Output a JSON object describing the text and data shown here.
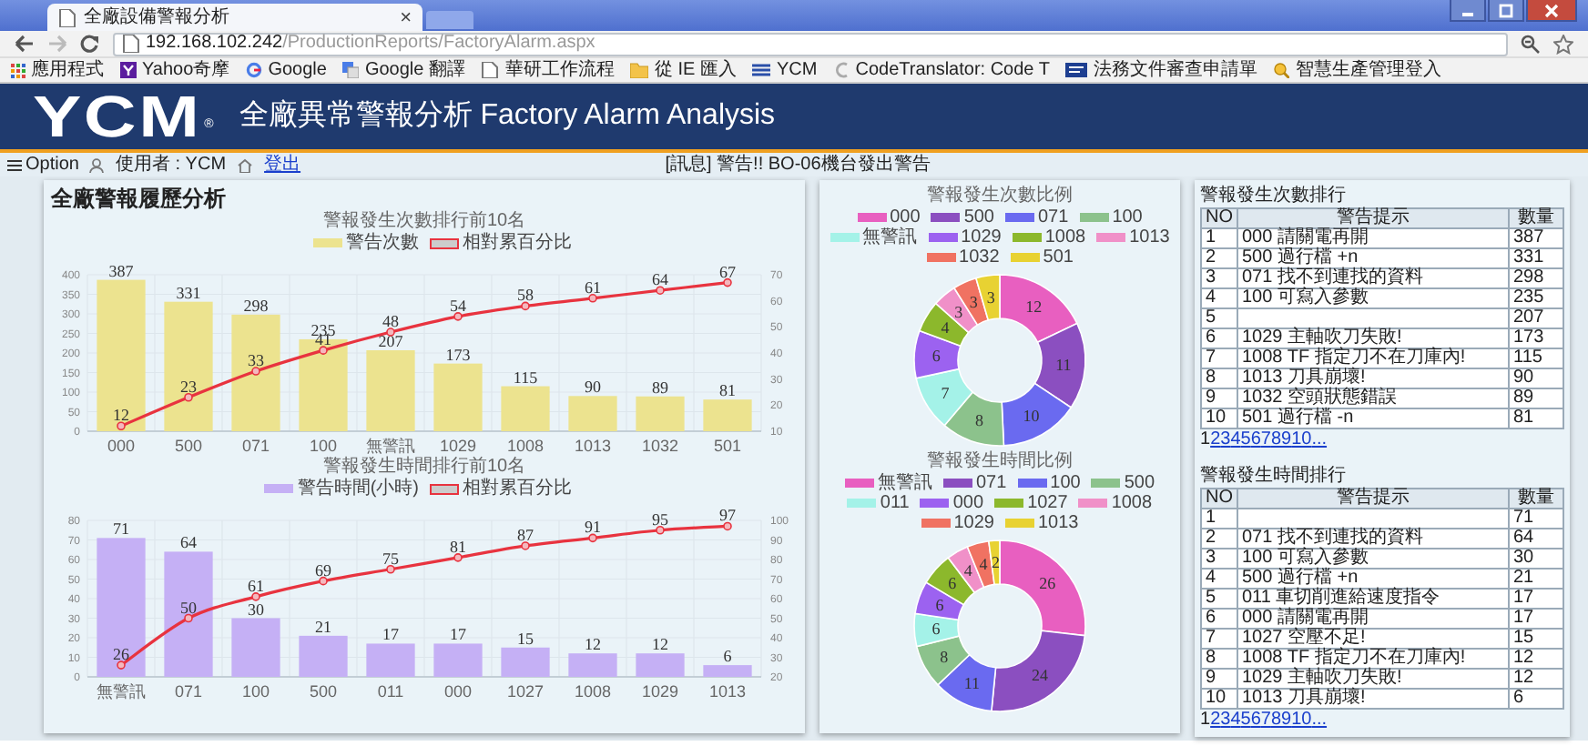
{
  "browser": {
    "tab_title": "全廠設備警報分析",
    "tab_close": "×",
    "address_host": "192.168.102.242",
    "address_path": "/ProductionReports/FactoryAlarm.aspx",
    "bookmarks": [
      {
        "label": "應用程式",
        "kind": "apps"
      },
      {
        "label": "Yahoo奇摩",
        "kind": "yahoo"
      },
      {
        "label": "Google",
        "kind": "google"
      },
      {
        "label": "Google 翻譯",
        "kind": "translate"
      },
      {
        "label": "華研工作流程",
        "kind": "page"
      },
      {
        "label": "從 IE 匯入",
        "kind": "folder"
      },
      {
        "label": "YCM",
        "kind": "ycm"
      },
      {
        "label": "CodeTranslator: Code T",
        "kind": "code"
      },
      {
        "label": "法務文件審查申請單",
        "kind": "doc"
      },
      {
        "label": "智慧生產管理登入",
        "kind": "search"
      }
    ]
  },
  "header": {
    "logo": "YCM",
    "logo_mark": "®",
    "title": "全廠異常警報分析 Factory Alarm Analysis"
  },
  "toolbar": {
    "menu": "Option",
    "user_label": "使用者 : YCM",
    "logout": "登出",
    "message": "[訊息] 警告!! BO-06機台發出警告"
  },
  "history": {
    "title": "全廠警報履歷分析",
    "charts": [
      {
        "chart_data": {
          "type": "bar",
          "title": "警報發生次數排行前10名",
          "categories": [
            "000",
            "500",
            "071",
            "100",
            "無警訊",
            "1029",
            "1008",
            "1013",
            "1032",
            "501"
          ],
          "ylim": [
            0,
            400
          ],
          "yticks": [
            0,
            50,
            100,
            150,
            200,
            250,
            300,
            350,
            400
          ],
          "grid": true,
          "legend": "top",
          "data_labels": true,
          "series": [
            {
              "name": "警告次數",
              "color": "#ece38f",
              "values": [
                387,
                331,
                298,
                235,
                207,
                173,
                115,
                90,
                89,
                81
              ]
            }
          ]
        },
        "overlay": {
          "chart_data": {
            "type": "line",
            "ylim": [
              10,
              70
            ],
            "yticks": [
              10,
              20,
              30,
              40,
              50,
              60,
              70
            ],
            "legend": "top",
            "data_labels": true,
            "series": [
              {
                "name": "相對累百分比",
                "color": "#e8333f",
                "marker": "circle",
                "values": [
                  12,
                  23,
                  33,
                  41,
                  48,
                  54,
                  58,
                  61,
                  64,
                  67
                ]
              }
            ]
          }
        }
      },
      {
        "chart_data": {
          "type": "bar",
          "title": "警報發生時間排行前10名",
          "categories": [
            "無警訊",
            "071",
            "100",
            "500",
            "011",
            "000",
            "1027",
            "1008",
            "1029",
            "1013"
          ],
          "ylim": [
            0,
            80
          ],
          "yticks": [
            0,
            10,
            20,
            30,
            40,
            50,
            60,
            70,
            80
          ],
          "grid": true,
          "legend": "top",
          "data_labels": true,
          "series": [
            {
              "name": "警告時間(小時)",
              "color": "#c5b0f5",
              "values": [
                71,
                64,
                30,
                21,
                17,
                17,
                15,
                12,
                12,
                6
              ]
            }
          ]
        },
        "overlay": {
          "chart_data": {
            "type": "line",
            "ylim": [
              20,
              100
            ],
            "yticks": [
              20,
              30,
              40,
              50,
              60,
              70,
              80,
              90,
              100
            ],
            "legend": "top",
            "data_labels": true,
            "series": [
              {
                "name": "相對累百分比",
                "color": "#e8333f",
                "marker": "circle",
                "values": [
                  26,
                  50,
                  61,
                  69,
                  75,
                  81,
                  87,
                  91,
                  95,
                  97
                ]
              }
            ]
          }
        }
      }
    ]
  },
  "ratios": {
    "charts": [
      {
        "chart_data": {
          "type": "donut",
          "title": "警報發生次數比例",
          "legend": "top",
          "categories": [
            "000",
            "500",
            "071",
            "100",
            "無警訊",
            "1029",
            "1008",
            "1013",
            "1032",
            "501"
          ],
          "values": [
            12,
            11,
            10,
            8,
            7,
            6,
            4,
            3,
            3,
            3
          ],
          "data_labels": true,
          "colors": [
            "#e85fc0",
            "#8b4fc0",
            "#6a6af0",
            "#8cc28c",
            "#a4f2e8",
            "#9c62f0",
            "#8cb82c",
            "#f090c8",
            "#f07262",
            "#e8d232"
          ]
        }
      },
      {
        "chart_data": {
          "type": "donut",
          "title": "警報發生時間比例",
          "legend": "top",
          "categories": [
            "無警訊",
            "071",
            "100",
            "500",
            "011",
            "000",
            "1027",
            "1008",
            "1029",
            "1013"
          ],
          "values": [
            26,
            24,
            11,
            8,
            6,
            6,
            6,
            4,
            4,
            2
          ],
          "data_labels": true,
          "colors": [
            "#e85fc0",
            "#8b4fc0",
            "#6a6af0",
            "#8cc28c",
            "#a4f2e8",
            "#9c62f0",
            "#8cb82c",
            "#f090c8",
            "#f07262",
            "#e8d232"
          ]
        }
      }
    ]
  },
  "rankings": [
    {
      "title": "警報發生次數排行",
      "columns": [
        "NO",
        "警告提示",
        "數量"
      ],
      "rows": [
        {
          "no": "1",
          "alarm": "000 請關電再開",
          "count": "387"
        },
        {
          "no": "2",
          "alarm": "500 過行檔 +n",
          "count": "331"
        },
        {
          "no": "3",
          "alarm": "071 找不到連找的資料",
          "count": "298"
        },
        {
          "no": "4",
          "alarm": "100 可寫入參數",
          "count": "235"
        },
        {
          "no": "5",
          "count": "207"
        },
        {
          "no": "6",
          "alarm": "1029 主軸吹刀失敗!",
          "count": "173"
        },
        {
          "no": "7",
          "alarm": "1008 TF 指定刀不在刀庫內!",
          "count": "115"
        },
        {
          "no": "8",
          "alarm": "1013 刀具崩壞!",
          "count": "90"
        },
        {
          "no": "9",
          "alarm": "1032 空頭狀態錯誤",
          "count": "89"
        },
        {
          "no": "10",
          "alarm": "501 過行檔 -n",
          "count": "81"
        }
      ],
      "pager": {
        "current": "1",
        "links": [
          "2",
          "3",
          "4",
          "5",
          "6",
          "7",
          "8",
          "9",
          "10",
          "..."
        ]
      }
    },
    {
      "title": "警報發生時間排行",
      "columns": [
        "NO",
        "警告提示",
        "數量"
      ],
      "rows": [
        {
          "no": "1",
          "count": "71"
        },
        {
          "no": "2",
          "alarm": "071 找不到連找的資料",
          "count": "64"
        },
        {
          "no": "3",
          "alarm": "100 可寫入參數",
          "count": "30"
        },
        {
          "no": "4",
          "alarm": "500 過行檔 +n",
          "count": "21"
        },
        {
          "no": "5",
          "alarm": "011 車切削進給速度指令",
          "count": "17"
        },
        {
          "no": "6",
          "alarm": "000 請關電再開",
          "count": "17"
        },
        {
          "no": "7",
          "alarm": "1027 空壓不足!",
          "count": "15"
        },
        {
          "no": "8",
          "alarm": "1008 TF 指定刀不在刀庫內!",
          "count": "12"
        },
        {
          "no": "9",
          "alarm": "1029 主軸吹刀失敗!",
          "count": "12"
        },
        {
          "no": "10",
          "alarm": "1013 刀具崩壞!",
          "count": "6"
        }
      ],
      "pager": {
        "current": "1",
        "links": [
          "2",
          "3",
          "4",
          "5",
          "6",
          "7",
          "8",
          "9",
          "10",
          "..."
        ]
      }
    }
  ]
}
